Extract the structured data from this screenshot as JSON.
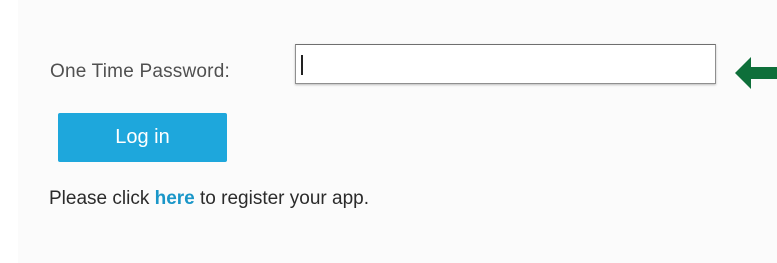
{
  "form": {
    "otp_label": "One Time Password:",
    "otp_value": "",
    "login_label": "Log in",
    "register_prefix": "Please click ",
    "register_link_text": "here",
    "register_suffix": " to register your app."
  },
  "colors": {
    "button_background": "#1ea7dc",
    "link": "#1a96c8",
    "arrow": "#0e6f3a"
  },
  "icons": {
    "pointer": "left-arrow-icon"
  }
}
